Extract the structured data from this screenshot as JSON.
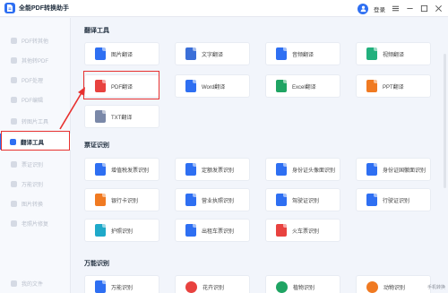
{
  "app": {
    "title": "全能PDF转换助手",
    "login_label": "登录"
  },
  "titlebar_icons": [
    "menu-icon",
    "minimize-icon",
    "maximize-icon",
    "close-icon"
  ],
  "sidebar": {
    "items": [
      {
        "label": "PDF转其他",
        "icon": "pdf-convert-icon",
        "active": false
      },
      {
        "label": "其他转PDF",
        "icon": "to-pdf-icon",
        "active": false
      },
      {
        "label": "PDF处理",
        "icon": "pdf-process-icon",
        "active": false
      },
      {
        "label": "PDF编辑",
        "icon": "pdf-edit-icon",
        "active": false
      },
      {
        "label": "转图片工具",
        "icon": "image-tool-icon",
        "active": false
      },
      {
        "label": "翻译工具",
        "icon": "translate-icon",
        "active": true
      },
      {
        "label": "票证识别",
        "icon": "ticket-icon",
        "active": false
      },
      {
        "label": "万能识别",
        "icon": "ocr-icon",
        "active": false
      },
      {
        "label": "图片转换",
        "icon": "image-convert-icon",
        "active": false
      },
      {
        "label": "老照片修复",
        "icon": "photo-repair-icon",
        "active": false
      }
    ],
    "bottom_label": "我的文件"
  },
  "sections": [
    {
      "title": "翻译工具",
      "cards": [
        {
          "label": "图片翻译",
          "icon": "image-translate-icon",
          "color": "#2e6ff2"
        },
        {
          "label": "文字翻译",
          "icon": "text-translate-icon",
          "color": "#3b6fd8"
        },
        {
          "label": "音频翻译",
          "icon": "audio-translate-icon",
          "color": "#2e6ff2"
        },
        {
          "label": "视频翻译",
          "icon": "video-translate-icon",
          "color": "#22b07d"
        },
        {
          "label": "PDF翻译",
          "icon": "pdf-translate-icon",
          "color": "#e8423f"
        },
        {
          "label": "Word翻译",
          "icon": "word-translate-icon",
          "color": "#2e6ff2"
        },
        {
          "label": "Excel翻译",
          "icon": "excel-translate-icon",
          "color": "#1fa463"
        },
        {
          "label": "PPT翻译",
          "icon": "ppt-translate-icon",
          "color": "#f07a22"
        },
        {
          "label": "TXT翻译",
          "icon": "txt-translate-icon",
          "color": "#7a88a8"
        }
      ]
    },
    {
      "title": "票证识别",
      "cards": [
        {
          "label": "增值税发票识别",
          "icon": "vat-invoice-icon",
          "color": "#2e6ff2"
        },
        {
          "label": "定额发票识别",
          "icon": "quota-invoice-icon",
          "color": "#2e6ff2"
        },
        {
          "label": "身份证头像面识别",
          "icon": "id-front-icon",
          "color": "#2e6ff2"
        },
        {
          "label": "身份证国徽面识别",
          "icon": "id-back-icon",
          "color": "#2e6ff2"
        },
        {
          "label": "银行卡识别",
          "icon": "bank-card-icon",
          "color": "#f07a22"
        },
        {
          "label": "营业执照识别",
          "icon": "business-license-icon",
          "color": "#2e6ff2"
        },
        {
          "label": "驾驶证识别",
          "icon": "driver-license-icon",
          "color": "#2e6ff2"
        },
        {
          "label": "行驶证识别",
          "icon": "vehicle-license-icon",
          "color": "#2e6ff2"
        },
        {
          "label": "护照识别",
          "icon": "passport-icon",
          "color": "#1fa9c9"
        },
        {
          "label": "出租车票识别",
          "icon": "taxi-ticket-icon",
          "color": "#2e6ff2"
        },
        {
          "label": "火车票识别",
          "icon": "train-ticket-icon",
          "color": "#e8423f"
        }
      ]
    },
    {
      "title": "万能识别",
      "cards": [
        {
          "label": "万能识别",
          "icon": "universal-ocr-icon",
          "color": "#2e6ff2"
        },
        {
          "label": "花卉识别",
          "icon": "flower-icon",
          "color": "#e8423f"
        },
        {
          "label": "植物识别",
          "icon": "plant-icon",
          "color": "#1fa463"
        },
        {
          "label": "动物识别",
          "icon": "animal-icon",
          "color": "#f07a22"
        }
      ]
    }
  ],
  "watermark": "手机转换"
}
